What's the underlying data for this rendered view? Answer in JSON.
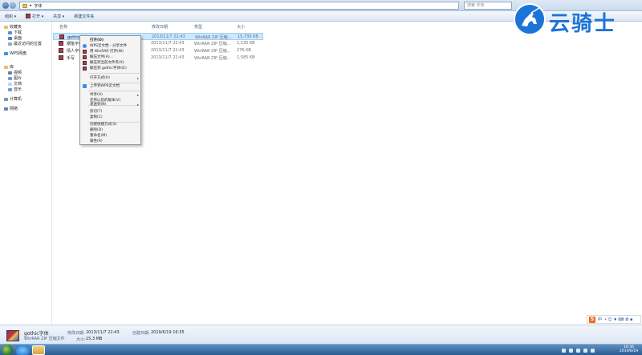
{
  "address": {
    "path": "字体",
    "crumb": "▸",
    "search_placeholder": "搜索 字体"
  },
  "toolbar": {
    "organize": "组织 ▾",
    "open": "打开 ▾",
    "share": "共享 ▾",
    "new_folder": "新建文件夹"
  },
  "nav": {
    "favorites": "收藏夹",
    "favorites_items": [
      "下载",
      "桌面",
      "最近访问的位置"
    ],
    "wps": "WPS网盘",
    "libraries": "库",
    "library_items": [
      "视频",
      "图片",
      "文档",
      "音乐"
    ],
    "computer": "计算机",
    "network": "网络"
  },
  "columns": {
    "name": "名称",
    "date": "修改日期",
    "type": "类型",
    "size": "大小"
  },
  "files": [
    {
      "name": "gothic字体",
      "date": "2013/11/7 22:43",
      "type": "WinRAR ZIP 压缩...",
      "size": "15,730 KB"
    },
    {
      "name": "钢笔字体",
      "date": "2013/11/7 22:43",
      "type": "WinRAR ZIP 压缩...",
      "size": "1,135 KB"
    },
    {
      "name": "情人字体",
      "date": "2013/11/7 22:43",
      "type": "WinRAR ZIP 压缩...",
      "size": "276 KB"
    },
    {
      "name": "手写",
      "date": "2013/11/7 22:43",
      "type": "WinRAR ZIP 压缩...",
      "size": "1,585 KB"
    }
  ],
  "menu": {
    "open": "打开(O)",
    "wps_share": "WPS云文档 - 分享文件",
    "open_winrar": "用 WinRAR 打开(W)",
    "extract_files": "解压文件(A)...",
    "extract_here": "解压到当前文件夹(X)",
    "extract_to": "解压到 gothic字体\\(E)",
    "open_with": "打开方式(H)",
    "upload_wps": "上传到WPS云文档",
    "share": "共享(H)",
    "restore": "还原以前的版本(V)",
    "send_to": "发送到(N)",
    "cut": "剪切(T)",
    "copy": "复制(C)",
    "shortcut": "创建快捷方式(S)",
    "delete": "删除(D)",
    "rename": "重命名(M)",
    "properties": "属性(R)",
    "arrow": "▸"
  },
  "logo": {
    "text": "云骑士"
  },
  "details": {
    "name": "gothic字体",
    "type": "WinRAR ZIP 压缩文件",
    "modified_label": "修改日期:",
    "modified": "2013/11/7 22:43",
    "created_label": "创建日期:",
    "created": "2019/6/19 16:35",
    "size_label": "大小:",
    "size": "15.3 MB"
  },
  "ime": {
    "s": "S",
    "lang": "中",
    "glyphs": "• ☺ ♦ ⌨ ✿ ▪"
  },
  "clock": {
    "time": "16:36",
    "date": "2019/6/19"
  },
  "colors": {
    "selection": "#cde8ff",
    "accent": "#1d74d8",
    "taskbar": "#2b5d92"
  }
}
